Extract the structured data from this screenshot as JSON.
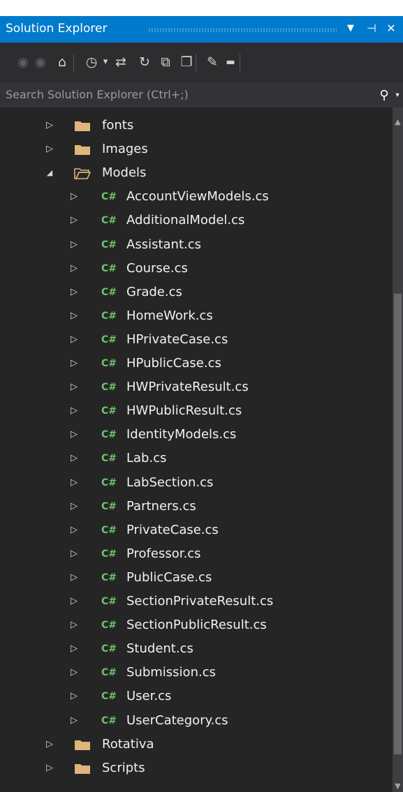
{
  "panel": {
    "title": "Solution Explorer",
    "dropdown_glyph": "▼",
    "pin_glyph": "⊣",
    "close_glyph": "✕"
  },
  "toolbar": {
    "icons": [
      {
        "name": "back-icon",
        "glyph": "◉",
        "enabled": false
      },
      {
        "name": "forward-icon",
        "glyph": "◉",
        "enabled": false
      },
      {
        "name": "home-icon",
        "glyph": "⌂",
        "enabled": true
      },
      {
        "name": "pending-changes-filter-icon",
        "glyph": "◷",
        "enabled": true
      },
      {
        "name": "filter-dropdown-icon",
        "glyph": "▾",
        "enabled": true
      },
      {
        "name": "sync-with-active-document-icon",
        "glyph": "⇄",
        "enabled": true
      },
      {
        "name": "refresh-icon",
        "glyph": "↻",
        "enabled": true
      },
      {
        "name": "collapse-all-icon",
        "glyph": "⧉",
        "enabled": true
      },
      {
        "name": "show-all-files-icon",
        "glyph": "❐",
        "enabled": true
      },
      {
        "name": "properties-wrench-icon",
        "glyph": "✎",
        "enabled": true
      },
      {
        "name": "preview-selected-items-icon",
        "glyph": "▬",
        "enabled": true
      }
    ]
  },
  "search": {
    "placeholder": "Search Solution Explorer (Ctrl+;)",
    "icon": "search-icon",
    "icon_glyph": "⚲",
    "dropdown_glyph": "▾"
  },
  "tree": {
    "cs_badge": "C#",
    "items": [
      {
        "label": "fonts",
        "kind": "folder",
        "expanded": false,
        "depth": 0
      },
      {
        "label": "Images",
        "kind": "folder",
        "expanded": false,
        "depth": 0
      },
      {
        "label": "Models",
        "kind": "folder",
        "expanded": true,
        "depth": 0
      },
      {
        "label": "AccountViewModels.cs",
        "kind": "cs",
        "expanded": false,
        "depth": 1
      },
      {
        "label": "AdditionalModel.cs",
        "kind": "cs",
        "expanded": false,
        "depth": 1
      },
      {
        "label": "Assistant.cs",
        "kind": "cs",
        "expanded": false,
        "depth": 1
      },
      {
        "label": "Course.cs",
        "kind": "cs",
        "expanded": false,
        "depth": 1
      },
      {
        "label": "Grade.cs",
        "kind": "cs",
        "expanded": false,
        "depth": 1
      },
      {
        "label": "HomeWork.cs",
        "kind": "cs",
        "expanded": false,
        "depth": 1
      },
      {
        "label": "HPrivateCase.cs",
        "kind": "cs",
        "expanded": false,
        "depth": 1
      },
      {
        "label": "HPublicCase.cs",
        "kind": "cs",
        "expanded": false,
        "depth": 1
      },
      {
        "label": "HWPrivateResult.cs",
        "kind": "cs",
        "expanded": false,
        "depth": 1
      },
      {
        "label": "HWPublicResult.cs",
        "kind": "cs",
        "expanded": false,
        "depth": 1
      },
      {
        "label": "IdentityModels.cs",
        "kind": "cs",
        "expanded": false,
        "depth": 1
      },
      {
        "label": "Lab.cs",
        "kind": "cs",
        "expanded": false,
        "depth": 1
      },
      {
        "label": "LabSection.cs",
        "kind": "cs",
        "expanded": false,
        "depth": 1
      },
      {
        "label": "Partners.cs",
        "kind": "cs",
        "expanded": false,
        "depth": 1
      },
      {
        "label": "PrivateCase.cs",
        "kind": "cs",
        "expanded": false,
        "depth": 1
      },
      {
        "label": "Professor.cs",
        "kind": "cs",
        "expanded": false,
        "depth": 1
      },
      {
        "label": "PublicCase.cs",
        "kind": "cs",
        "expanded": false,
        "depth": 1
      },
      {
        "label": "SectionPrivateResult.cs",
        "kind": "cs",
        "expanded": false,
        "depth": 1
      },
      {
        "label": "SectionPublicResult.cs",
        "kind": "cs",
        "expanded": false,
        "depth": 1
      },
      {
        "label": "Student.cs",
        "kind": "cs",
        "expanded": false,
        "depth": 1
      },
      {
        "label": "Submission.cs",
        "kind": "cs",
        "expanded": false,
        "depth": 1
      },
      {
        "label": "User.cs",
        "kind": "cs",
        "expanded": false,
        "depth": 1
      },
      {
        "label": "UserCategory.cs",
        "kind": "cs",
        "expanded": false,
        "depth": 1
      },
      {
        "label": "Rotativa",
        "kind": "folder",
        "expanded": false,
        "depth": 0
      },
      {
        "label": "Scripts",
        "kind": "folder",
        "expanded": false,
        "depth": 0
      }
    ]
  },
  "scrollbar": {
    "up_glyph": "▲",
    "down_glyph": "▼",
    "thumb_start": 0.255,
    "thumb_size": 0.71
  },
  "colors": {
    "accent": "#007acc",
    "panel_bg": "#252526",
    "folder": "#dcb67a",
    "cs_badge": "#6cc36c",
    "text": "#f1f1f1"
  }
}
